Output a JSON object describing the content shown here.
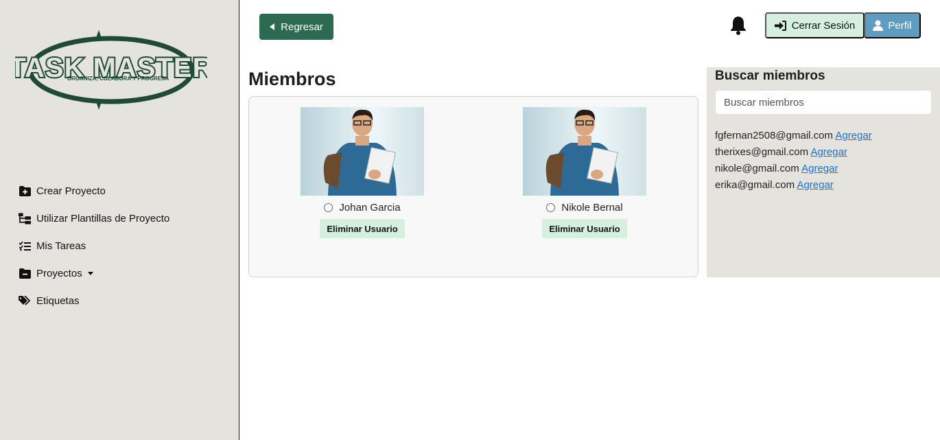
{
  "brand": {
    "logo_text": "TASK MASTER",
    "tagline": "ORGANIZA, COLABORA Y PROGRESA",
    "color": "#1f4a36"
  },
  "sidebar": {
    "items": [
      {
        "label": "Crear Proyecto",
        "icon": "folder-plus-icon"
      },
      {
        "label": "Utilizar Plantillas de Proyecto",
        "icon": "template-tree-icon"
      },
      {
        "label": "Mis Tareas",
        "icon": "task-list-icon"
      },
      {
        "label": "Proyectos",
        "icon": "folder-minus-icon"
      },
      {
        "label": "Etiquetas",
        "icon": "tags-icon"
      }
    ]
  },
  "header": {
    "back_label": "Regresar",
    "logout_label": "Cerrar Sesión",
    "profile_label": "Perfil"
  },
  "main": {
    "title": "Miembros",
    "members": [
      {
        "name": "Johan Garcia",
        "remove_label": "Eliminar Usuario"
      },
      {
        "name": "Nikole Bernal",
        "remove_label": "Eliminar Usuario"
      }
    ]
  },
  "search": {
    "title": "Buscar miembros",
    "placeholder": "Buscar miembros",
    "results": [
      {
        "email": "fgfernan2508@gmail.com",
        "action": "Agregar"
      },
      {
        "email": "therixes@gmail.com",
        "action": "Agregar"
      },
      {
        "email": "nikole@gmail.com",
        "action": "Agregar"
      },
      {
        "email": "erika@gmail.com",
        "action": "Agregar"
      }
    ]
  },
  "colors": {
    "sidebar_bg": "#e4e3de",
    "primary_green": "#2d6a52",
    "light_green": "#d6f0e0",
    "profile_blue": "#5f9cc2",
    "link_blue": "#1a6fd8"
  }
}
